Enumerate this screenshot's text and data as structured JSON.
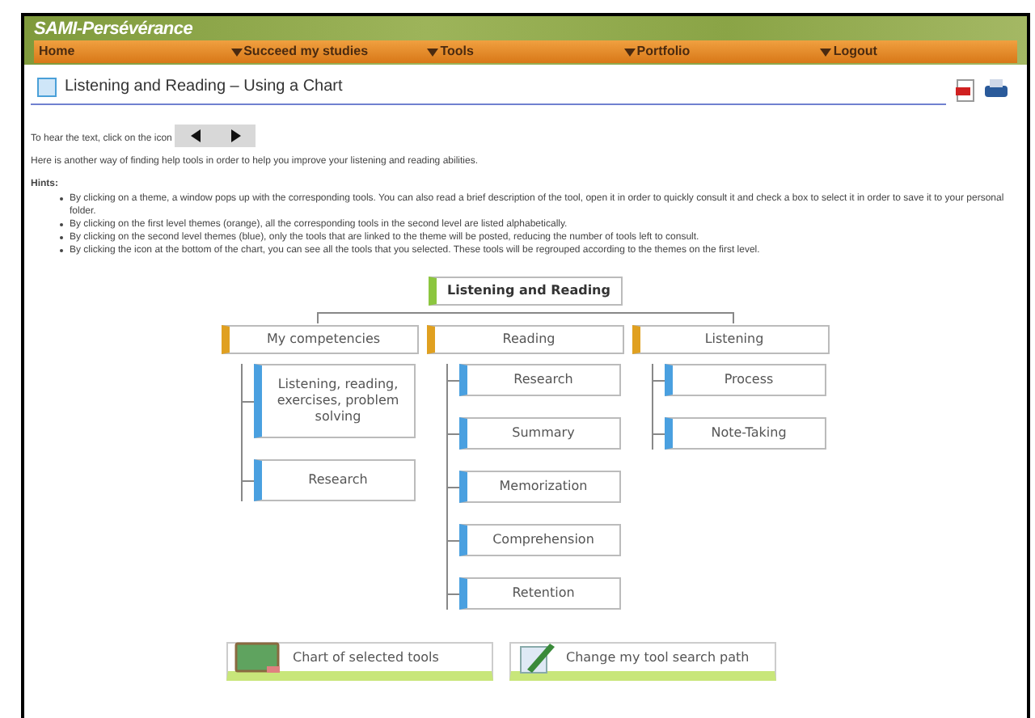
{
  "logo": "SAMI-Persévérance",
  "nav": [
    {
      "label": "Home",
      "dropdown": false
    },
    {
      "label": "Succeed my studies",
      "dropdown": true
    },
    {
      "label": "Tools",
      "dropdown": true
    },
    {
      "label": "Portfolio",
      "dropdown": true
    },
    {
      "label": "Logout",
      "dropdown": true
    }
  ],
  "page_title": "Listening and Reading – Using a Chart",
  "audio_prompt": "To hear the text, click on the icon",
  "intro": "Here is another way of finding help tools in order to help you improve your listening and reading abilities.",
  "hints_title": "Hints:",
  "hints": [
    "By clicking on a theme, a window pops up with the corresponding tools. You can also read a brief description of the tool, open it in order to quickly consult it and check a box to select it in order to save it to your personal folder.",
    "By clicking on the first level themes (orange), all the corresponding tools in the second level are listed alphabetically.",
    "By clicking on the second level themes (blue), only the tools that are linked to the theme will be posted, reducing the number of tools left to consult.",
    "By clicking the icon at the bottom of the chart, you can see all the tools that you selected. These tools will be regrouped according to the themes on the first level."
  ],
  "chart": {
    "root": "Listening and Reading",
    "themes": [
      {
        "label": "My competencies",
        "children": [
          "Listening, reading, exercises, problem solving",
          "Research"
        ]
      },
      {
        "label": "Reading",
        "children": [
          "Research",
          "Summary",
          "Memorization",
          "Comprehension",
          "Retention"
        ]
      },
      {
        "label": "Listening",
        "children": [
          "Process",
          "Note-Taking"
        ]
      }
    ]
  },
  "bottom_buttons": [
    {
      "label": "Chart of selected tools",
      "kind": "board"
    },
    {
      "label": "Change my tool search path",
      "kind": "pen"
    }
  ]
}
